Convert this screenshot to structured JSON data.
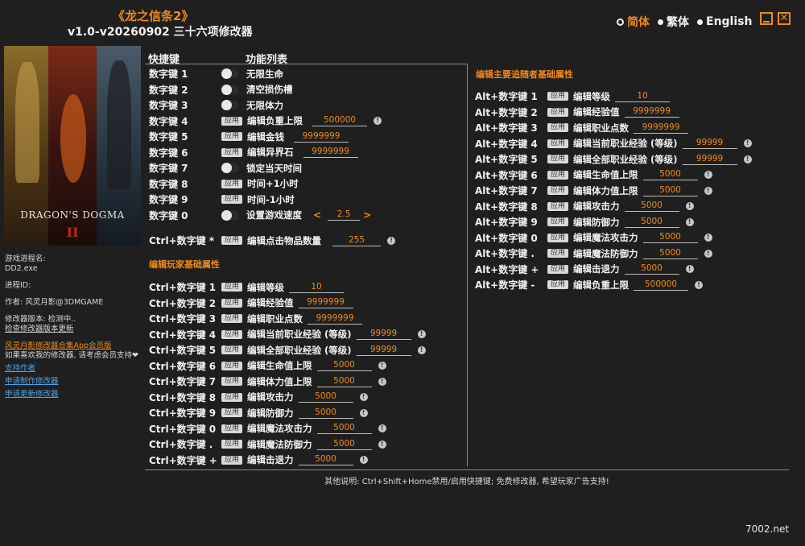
{
  "header": {
    "game_title": "《龙之信条2》",
    "version_title": "v1.0-v20260902 三十六项修改器"
  },
  "languages": [
    {
      "label": "简体",
      "active": true
    },
    {
      "label": "繁体",
      "active": false
    },
    {
      "label": "English",
      "active": false
    }
  ],
  "cover": {
    "logo_text": "DRAGON'S DOGMA",
    "logo_numeral": "II"
  },
  "left": {
    "process_label": "游戏进程名:",
    "process_value": "DD2.exe",
    "pid_label": "进程ID:",
    "author": "作者: 风灵月影@3DMGAME",
    "mod_version": "修改器版本: 检测中..",
    "check_update": "检查修改器版本更新",
    "vip": "风灵月影修改器合集App会员版",
    "support_text": "如果喜欢我的修改器, 请考虑会员支持❤",
    "support_author": "支持作者",
    "request_new": "申请制作修改器",
    "request_update": "申请更新修改器"
  },
  "columns": {
    "hotkey": "快捷键",
    "functions": "功能列表"
  },
  "apply_label": "应用",
  "general": [
    {
      "key": "数字键 1",
      "type": "toggle",
      "label": "无限生命"
    },
    {
      "key": "数字键 2",
      "type": "toggle",
      "label": "清空损伤槽"
    },
    {
      "key": "数字键 3",
      "type": "toggle",
      "label": "无限体力"
    },
    {
      "key": "数字键 4",
      "type": "apply",
      "label": "编辑负重上限",
      "value": "500000",
      "info": true
    },
    {
      "key": "数字键 5",
      "type": "apply",
      "label": "编辑金钱",
      "value": "9999999",
      "info": false
    },
    {
      "key": "数字键 6",
      "type": "apply",
      "label": "编辑异界石",
      "value": "9999999",
      "info": false
    },
    {
      "key": "数字键 7",
      "type": "toggle",
      "label": "锁定当天时间"
    },
    {
      "key": "数字键 8",
      "type": "apply",
      "label": "时间+1小时"
    },
    {
      "key": "数字键 9",
      "type": "apply",
      "label": "时间-1小时"
    },
    {
      "key": "数字键 0",
      "type": "speed",
      "label": "设置游戏速度",
      "value": "2.5"
    }
  ],
  "item_row": {
    "key": "Ctrl+数字键 *",
    "label": "编辑点击物品数量",
    "value": "255"
  },
  "player_section_title": "编辑玩家基础属性",
  "player": [
    {
      "key": "Ctrl+数字键 1",
      "label": "编辑等级",
      "value": "10",
      "info": false
    },
    {
      "key": "Ctrl+数字键 2",
      "label": "编辑经验值",
      "value": "9999999",
      "info": false
    },
    {
      "key": "Ctrl+数字键 3",
      "label": "编辑职业点数",
      "value": "9999999",
      "info": false
    },
    {
      "key": "Ctrl+数字键 4",
      "label": "编辑当前职业经验 (等级)",
      "value": "99999",
      "info": true
    },
    {
      "key": "Ctrl+数字键 5",
      "label": "编辑全部职业经验 (等级)",
      "value": "99999",
      "info": true
    },
    {
      "key": "Ctrl+数字键 6",
      "label": "编辑生命值上限",
      "value": "5000",
      "info": true
    },
    {
      "key": "Ctrl+数字键 7",
      "label": "编辑体力值上限",
      "value": "5000",
      "info": true
    },
    {
      "key": "Ctrl+数字键 8",
      "label": "编辑攻击力",
      "value": "5000",
      "info": true
    },
    {
      "key": "Ctrl+数字键 9",
      "label": "编辑防御力",
      "value": "5000",
      "info": true
    },
    {
      "key": "Ctrl+数字键 0",
      "label": "编辑魔法攻击力",
      "value": "5000",
      "info": true
    },
    {
      "key": "Ctrl+数字键 .",
      "label": "编辑魔法防御力",
      "value": "5000",
      "info": true
    },
    {
      "key": "Ctrl+数字键 +",
      "label": "编辑击退力",
      "value": "5000",
      "info": true
    }
  ],
  "pawn_section_title": "编辑主要追随者基础属性",
  "pawn": [
    {
      "key": "Alt+数字键 1",
      "label": "编辑等级",
      "value": "10",
      "info": false
    },
    {
      "key": "Alt+数字键 2",
      "label": "编辑经验值",
      "value": "9999999",
      "info": false
    },
    {
      "key": "Alt+数字键 3",
      "label": "编辑职业点数",
      "value": "9999999",
      "info": false
    },
    {
      "key": "Alt+数字键 4",
      "label": "编辑当前职业经验 (等级)",
      "value": "99999",
      "info": true
    },
    {
      "key": "Alt+数字键 5",
      "label": "编辑全部职业经验 (等级)",
      "value": "99999",
      "info": true
    },
    {
      "key": "Alt+数字键 6",
      "label": "编辑生命值上限",
      "value": "5000",
      "info": true
    },
    {
      "key": "Alt+数字键 7",
      "label": "编辑体力值上限",
      "value": "5000",
      "info": true
    },
    {
      "key": "Alt+数字键 8",
      "label": "编辑攻击力",
      "value": "5000",
      "info": true
    },
    {
      "key": "Alt+数字键 9",
      "label": "编辑防御力",
      "value": "5000",
      "info": true
    },
    {
      "key": "Alt+数字键 0",
      "label": "编辑魔法攻击力",
      "value": "5000",
      "info": true
    },
    {
      "key": "Alt+数字键 .",
      "label": "编辑魔法防御力",
      "value": "5000",
      "info": true
    },
    {
      "key": "Alt+数字键 +",
      "label": "编辑击退力",
      "value": "5000",
      "info": true
    },
    {
      "key": "Alt+数字键 -",
      "label": "编辑负重上限",
      "value": "500000",
      "info": true
    }
  ],
  "footer": "其他说明: Ctrl+Shift+Home禁用/启用快捷键; 免费修改器, 希望玩家广告支持!",
  "watermark": "7002.net"
}
